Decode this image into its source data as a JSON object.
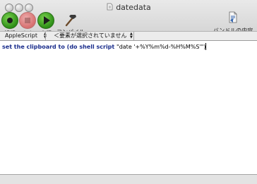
{
  "window": {
    "title": "datedata"
  },
  "toolbar": {
    "record_label": "記録",
    "stop_label": "中止",
    "run_label": "実行",
    "compile_label": "コンパイル",
    "bundle_label": "バンドルの内容"
  },
  "navbar": {
    "language": "AppleScript",
    "element_placeholder": "＜要素が選択されていません＞"
  },
  "editor": {
    "kw1": "set the clipboard to ",
    "kw2": "(do shell script ",
    "str": "\"date '+%Y%m%d-%H%M%S'\"",
    "close": ")"
  },
  "colors": {
    "keyword": "#1a2d8c",
    "run_green": "#2d8e17",
    "stop_red": "#d64d4d"
  }
}
